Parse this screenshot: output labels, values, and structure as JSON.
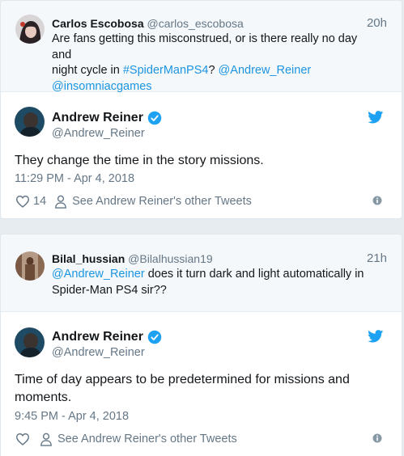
{
  "thread1": {
    "reply": {
      "name": "Carlos Escobosa",
      "handle": "@carlos_escobosa",
      "time": "20h",
      "text_line1": "Are fans getting this misconstrued, or is there really no day and",
      "text_line2_plain": "night cycle in ",
      "hashtag": "#SpiderManPS4",
      "text_line2_sep": "? ",
      "mention1": "@Andrew_Reiner",
      "mention2": "@insomniacgames"
    },
    "tweet": {
      "name": "Andrew Reiner",
      "handle": "@Andrew_Reiner",
      "text": "They change the time in the story missions.",
      "timestamp": "11:29 PM - Apr 4, 2018",
      "likes": "14",
      "other_tweets": "See Andrew Reiner's other Tweets"
    }
  },
  "thread2": {
    "reply": {
      "name": "Bilal_hussian",
      "handle": "@Bilalhussian19",
      "time": "21h",
      "mention": "@Andrew_Reiner",
      "text_line1_rest": " does it turn dark and light automatically in",
      "text_line2": "Spider-Man PS4 sir??"
    },
    "tweet": {
      "name": "Andrew Reiner",
      "handle": "@Andrew_Reiner",
      "text_line1": "Time of day appears to be predetermined for missions and",
      "text_line2": "moments.",
      "timestamp": "9:45 PM - Apr 4, 2018",
      "other_tweets": "See Andrew Reiner's other Tweets"
    }
  },
  "colors": {
    "link": "#1b95e0",
    "muted": "#657786",
    "verified": "#1da1f2",
    "page_bg": "#e6ecf0",
    "reply_bg": "#f5f8fa"
  },
  "icons": [
    "verified-badge-icon",
    "twitter-bird-icon",
    "heart-icon",
    "person-icon",
    "info-icon"
  ]
}
